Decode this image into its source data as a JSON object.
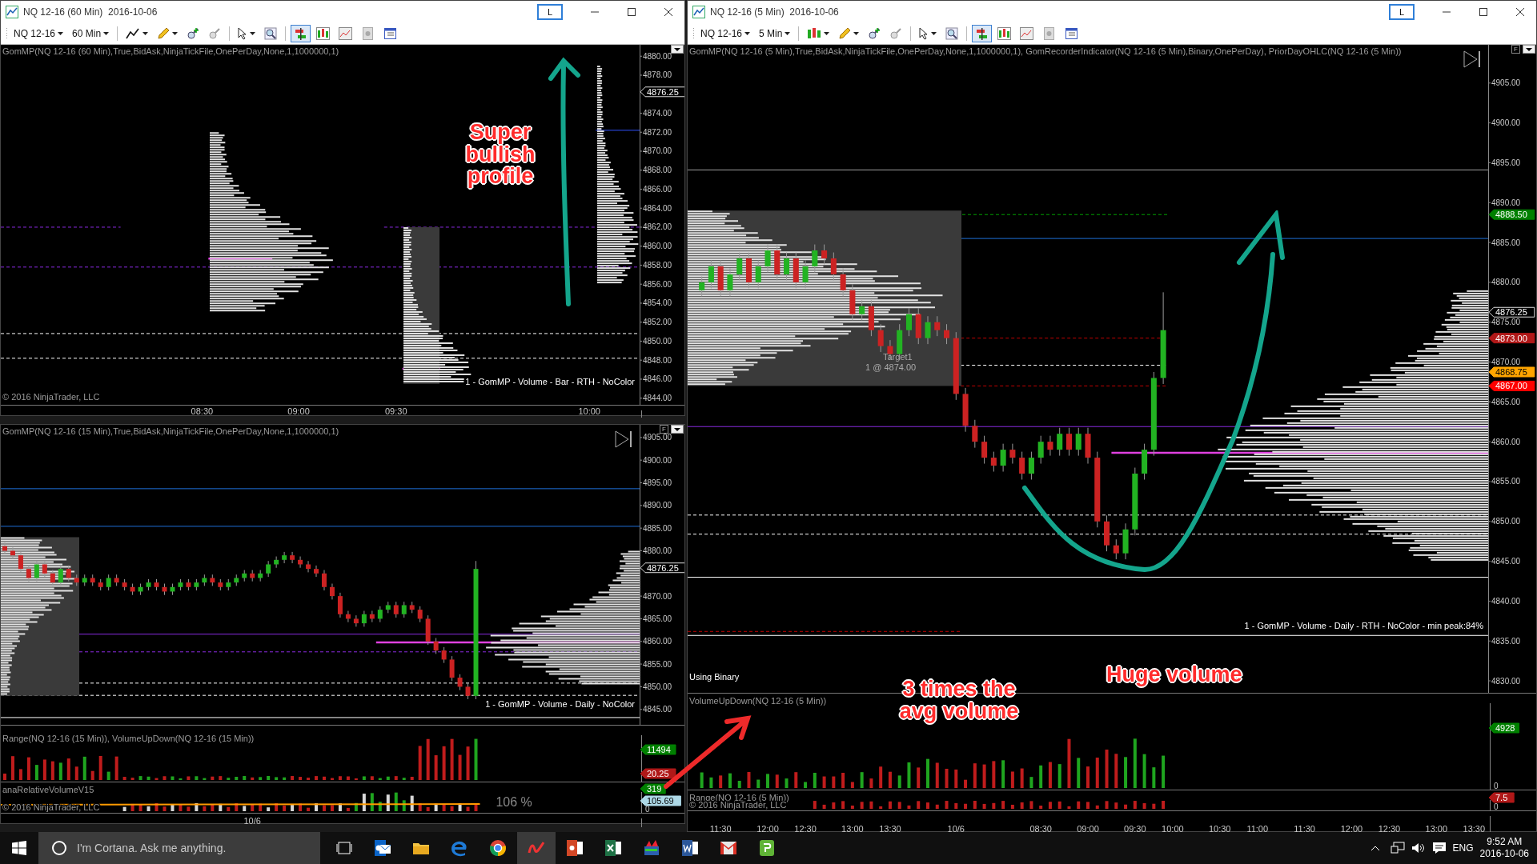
{
  "windows": [
    {
      "title": "NQ 12-16 (60 Min)  2016-10-06",
      "link_button": "L",
      "instrument": "NQ 12-16",
      "interval": "60 Min",
      "chart_style": {
        "kind": "line"
      },
      "view_buttons": [
        {
          "kind": "trader",
          "selected": true
        },
        {
          "kind": "candles",
          "selected": false
        },
        {
          "kind": "chart",
          "selected": false
        },
        {
          "kind": "dollar",
          "selected": false
        },
        {
          "kind": "table",
          "selected": false
        }
      ],
      "indicator_label": "GomMP(NQ 12-16 (60 Min),True,BidAsk,NinjaTickFile,OnePerDay,None,1,1000000,1)",
      "copyright": "© 2016 NinjaTrader, LLC",
      "profile_label": "1 - GomMP - Volume - Bar - RTH - NoColor",
      "price_axis": [
        "4880.00",
        "4878.00",
        "4874.00",
        "4872.00",
        "4870.00",
        "4868.00",
        "4866.00",
        "4864.00",
        "4862.00",
        "4860.00",
        "4858.00",
        "4856.00",
        "4854.00",
        "4852.00",
        "4850.00",
        "4848.00",
        "4846.00",
        "4844.00"
      ],
      "time_axis": [
        "08:30",
        "09:00",
        "09:30",
        "10:00"
      ],
      "price_markers": [
        {
          "text": "4876.25",
          "color": "#000000"
        }
      ]
    },
    {
      "f_button": "F",
      "indicator_label": "GomMP(NQ 12-16 (15 Min),True,BidAsk,NinjaTickFile,OnePerDay,None,1,1000000,1)",
      "profile_label": "1 - GomMP - Volume - Daily - NoColor",
      "price_markers": [
        {
          "text": "4876.25",
          "color": "#000000"
        }
      ],
      "time_axis": [
        "10/6"
      ],
      "chart_data": {
        "type": "candlestick",
        "ylim": [
          4841.6,
          4907.8
        ],
        "yticks": [
          {
            "value": 4905,
            "label": "4905.00"
          },
          {
            "value": 4900,
            "label": "4900.00"
          },
          {
            "value": 4895,
            "label": "4895.00"
          },
          {
            "value": 4890,
            "label": "4890.00"
          },
          {
            "value": 4885,
            "label": "4885.00"
          },
          {
            "value": 4880,
            "label": "4880.00"
          },
          {
            "value": 4870,
            "label": "4870.00"
          },
          {
            "value": 4865,
            "label": "4865.00"
          },
          {
            "value": 4860,
            "label": "4860.00"
          },
          {
            "value": 4855,
            "label": "4855.00"
          },
          {
            "value": 4850,
            "label": "4850.00"
          },
          {
            "value": 4845,
            "label": "4845.00"
          }
        ],
        "categories": [
          null,
          null,
          null,
          null,
          null,
          null,
          null,
          null,
          null,
          null,
          null,
          null,
          null,
          null,
          null,
          null,
          null,
          null,
          null,
          null,
          null,
          null,
          null,
          null,
          null,
          null,
          null,
          null,
          null,
          null,
          null,
          null,
          null,
          null,
          null,
          null,
          null,
          null,
          null,
          null,
          null,
          null,
          null,
          null,
          null,
          null,
          null,
          null,
          null,
          null,
          null,
          null,
          null,
          null,
          null,
          null,
          null,
          null,
          null,
          null,
          null,
          null,
          null,
          null,
          null,
          null,
          null,
          null,
          null,
          null,
          null,
          null,
          null,
          null,
          null,
          null,
          null,
          null,
          null,
          null
        ],
        "ohlc": [
          [
            4881,
            4881.75,
            4879.25,
            4880
          ],
          [
            4880,
            4880.75,
            4878.25,
            4879
          ],
          [
            4879,
            4879.75,
            4875.25,
            4876
          ],
          [
            4876,
            4876.75,
            4873.25,
            4874
          ],
          [
            4874,
            4877.75,
            4873.25,
            4877
          ],
          [
            4877,
            4877.75,
            4874.25,
            4875
          ],
          [
            4875,
            4875.75,
            4872.25,
            4873
          ],
          [
            4873,
            4876.75,
            4872.25,
            4876
          ],
          [
            4876,
            4876.75,
            4873.25,
            4874
          ],
          [
            4874,
            4874.75,
            4872.25,
            4873
          ],
          [
            4873,
            4874.75,
            4872.25,
            4874
          ],
          [
            4874,
            4874.75,
            4872.25,
            4873
          ],
          [
            4873,
            4873.75,
            4871.25,
            4872
          ],
          [
            4872,
            4874.75,
            4871.25,
            4874
          ],
          [
            4874,
            4874.75,
            4872.25,
            4873
          ],
          [
            4873,
            4873.75,
            4871.25,
            4872
          ],
          [
            4872,
            4872.75,
            4870.25,
            4871
          ],
          [
            4871,
            4872.75,
            4870.25,
            4872
          ],
          [
            4872,
            4873.75,
            4871.25,
            4873
          ],
          [
            4873,
            4873.75,
            4871.25,
            4872
          ],
          [
            4872,
            4872.75,
            4870.25,
            4871
          ],
          [
            4871,
            4872.75,
            4870.25,
            4872
          ],
          [
            4872,
            4873.75,
            4871.25,
            4873
          ],
          [
            4873,
            4873.75,
            4871.25,
            4872
          ],
          [
            4872,
            4873.75,
            4871.25,
            4873
          ],
          [
            4873,
            4874.75,
            4872.25,
            4874
          ],
          [
            4874,
            4874.75,
            4872.25,
            4873
          ],
          [
            4873,
            4873.75,
            4871.25,
            4872
          ],
          [
            4872,
            4873.75,
            4871.25,
            4873
          ],
          [
            4873,
            4874.75,
            4872.25,
            4874
          ],
          [
            4874,
            4875.75,
            4873.25,
            4875
          ],
          [
            4875,
            4875.75,
            4873.25,
            4874
          ],
          [
            4874,
            4875.75,
            4873.25,
            4875
          ],
          [
            4875,
            4877.75,
            4874.25,
            4877
          ],
          [
            4877,
            4878.75,
            4876.25,
            4878
          ],
          [
            4878,
            4879.75,
            4877.25,
            4879
          ],
          [
            4879,
            4879.75,
            4877.25,
            4878
          ],
          [
            4878,
            4878.75,
            4876.25,
            4877
          ],
          [
            4877,
            4877.75,
            4875.25,
            4876
          ],
          [
            4876,
            4876.75,
            4874.25,
            4875
          ],
          [
            4875,
            4875.75,
            4871.25,
            4872
          ],
          [
            4872,
            4872.75,
            4869.25,
            4870
          ],
          [
            4870,
            4870.75,
            4865.25,
            4866
          ],
          [
            4866,
            4866.75,
            4864.25,
            4865
          ],
          [
            4865,
            4865.75,
            4863.25,
            4864
          ],
          [
            4864,
            4866.75,
            4863.25,
            4866
          ],
          [
            4866,
            4866.75,
            4864.25,
            4865
          ],
          [
            4865,
            4867.75,
            4864.25,
            4867
          ],
          [
            4867,
            4868.75,
            4866.25,
            4868
          ],
          [
            4868,
            4868.75,
            4865.25,
            4866
          ],
          [
            4866,
            4868.75,
            4865.25,
            4868
          ],
          [
            4868,
            4868.75,
            4866.25,
            4867
          ],
          [
            4867,
            4867.75,
            4864.25,
            4865
          ],
          [
            4865,
            4865.75,
            4859.25,
            4860
          ],
          [
            4860,
            4860.75,
            4857.25,
            4858
          ],
          [
            4858,
            4858.75,
            4855.25,
            4856
          ],
          [
            4856,
            4856.75,
            4851.25,
            4852
          ],
          [
            4852,
            4852.75,
            4849.25,
            4850
          ],
          [
            4850,
            4850.75,
            4847.25,
            4848
          ],
          [
            4848,
            4877.75,
            4847.25,
            4876
          ],
          null,
          null,
          null,
          null,
          null,
          null,
          null,
          null,
          null,
          null,
          null,
          null,
          null,
          null,
          null,
          null,
          null,
          null,
          null,
          null
        ]
      },
      "sub_panels": [
        {
          "kind": "volume",
          "label": "Range(NQ 12-16 (15 Min)), VolumeUpDown(NQ 12-16 (15 Min))",
          "markers": [
            {
              "text": "11494",
              "color": "#008000"
            },
            {
              "text": "20.25",
              "color": "#b01818"
            }
          ]
        },
        {
          "kind": "relative",
          "label": "anaRelativeVolumeV15",
          "copyright": "© 2016 NinjaTrader, LLC",
          "reading": "106 %",
          "markers": [
            {
              "text": "319",
              "color": "#008000"
            },
            {
              "text": "105.69",
              "color": "#add8e6"
            }
          ],
          "axis": [
            "0"
          ]
        }
      ]
    },
    {
      "title": "NQ 12-16 (5 Min)  2016-10-06",
      "link_button": "L",
      "instrument": "NQ 12-16",
      "interval": "5 Min",
      "chart_style": {
        "kind": "candlestick"
      },
      "f_button": "F",
      "view_buttons": [
        {
          "kind": "trader",
          "selected": true
        },
        {
          "kind": "candles",
          "selected": false
        },
        {
          "kind": "chart",
          "selected": false
        },
        {
          "kind": "dollar",
          "selected": false
        },
        {
          "kind": "table",
          "selected": false
        }
      ],
      "indicator_label": "GomMP(NQ 12-16 (5 Min),True,BidAsk,NinjaTickFile,OnePerDay,None,1,1000000,1), GomRecorderIndicator(NQ 12-16 (5 Min),Binary,OnePerDay), PriorDayOHLC(NQ 12-16 (5 Min))",
      "order_label": "Target1",
      "order_detail": "1 @ 4874.00",
      "status_label": "Using Binary",
      "profile_label": "1 - GomMP - Volume - Daily - RTH - NoColor - min peak:84%",
      "price_markers": [
        {
          "text": "4888.50",
          "color": "#008000"
        },
        {
          "text": "4876.25",
          "color": "#000000"
        },
        {
          "text": "4873.00",
          "color": "#b01818"
        },
        {
          "text": "4868.75",
          "color": "#ffa500"
        },
        {
          "text": "4867.00",
          "color": "#ff0000"
        }
      ],
      "time_axis": [
        "11:30",
        "12:00",
        "12:30",
        "13:00",
        "13:30",
        "10/6",
        "08:30",
        "09:00",
        "09:30",
        "10:00",
        "10:30",
        "11:00",
        "11:30",
        "12:00",
        "12:30",
        "13:00",
        "13:30"
      ],
      "chart_data": {
        "type": "candlestick",
        "ylim": [
          4828.5,
          4909.8
        ],
        "yticks": [
          {
            "value": 4905,
            "label": "4905.00"
          },
          {
            "value": 4900,
            "label": "4900.00"
          },
          {
            "value": 4895,
            "label": "4895.00"
          },
          {
            "value": 4890,
            "label": "4890.00"
          },
          {
            "value": 4885,
            "label": "4885.00"
          },
          {
            "value": 4880,
            "label": "4880.00"
          },
          {
            "value": 4875,
            "label": "4875.00"
          },
          {
            "value": 4870,
            "label": "4870.00"
          },
          {
            "value": 4865,
            "label": "4865.00"
          },
          {
            "value": 4860,
            "label": "4860.00"
          },
          {
            "value": 4855,
            "label": "4855.00"
          },
          {
            "value": 4850,
            "label": "4850.00"
          },
          {
            "value": 4845,
            "label": "4845.00"
          },
          {
            "value": 4840,
            "label": "4840.00"
          },
          {
            "value": 4835,
            "label": "4835.00"
          },
          {
            "value": 4830,
            "label": "4830.00"
          }
        ],
        "categories": [
          null,
          null,
          null,
          null,
          null,
          null,
          null,
          null,
          null,
          null,
          null,
          null,
          null,
          null,
          null,
          null,
          null,
          null,
          null,
          null,
          null,
          null,
          null,
          null,
          null,
          null,
          null,
          null,
          null,
          null,
          null,
          null,
          null,
          null,
          null,
          null,
          null,
          null,
          null,
          null,
          null,
          null,
          null,
          null,
          null,
          null,
          null,
          null,
          null,
          null,
          null,
          null,
          null,
          null,
          null,
          null,
          null,
          null,
          null,
          null,
          null,
          null,
          null,
          null,
          null,
          null,
          null,
          null,
          null,
          null,
          null,
          null,
          null,
          null,
          null,
          null,
          null,
          null,
          null,
          null,
          null,
          null,
          null,
          null,
          null
        ],
        "ohlc": [
          null,
          [
            4879,
            4880.75,
            4878.25,
            4880
          ],
          [
            4880,
            4882.75,
            4879.25,
            4882
          ],
          [
            4882,
            4882.75,
            4878.25,
            4879
          ],
          [
            4879,
            4881.75,
            4878.25,
            4881
          ],
          [
            4881,
            4883.75,
            4880.25,
            4883
          ],
          [
            4883,
            4883.75,
            4879.25,
            4880
          ],
          [
            4880,
            4882.75,
            4879.25,
            4882
          ],
          [
            4882,
            4884.75,
            4881.25,
            4884
          ],
          [
            4884,
            4884.75,
            4880.25,
            4881
          ],
          [
            4881,
            4883.75,
            4880.25,
            4883
          ],
          [
            4883,
            4883.75,
            4879.25,
            4880
          ],
          [
            4880,
            4882.75,
            4879.25,
            4882
          ],
          [
            4882,
            4884.75,
            4881.25,
            4884
          ],
          [
            4884,
            4884.75,
            4882.25,
            4883
          ],
          [
            4883,
            4883.75,
            4880.25,
            4881
          ],
          [
            4881,
            4881.75,
            4878.25,
            4879
          ],
          [
            4879,
            4879.75,
            4875.25,
            4876
          ],
          [
            4876,
            4877.75,
            4875.25,
            4877
          ],
          [
            4877,
            4877.75,
            4873.25,
            4874
          ],
          [
            4874,
            4874.75,
            4871.25,
            4872
          ],
          [
            4872,
            4872.75,
            4870.25,
            4871
          ],
          [
            4871,
            4874.75,
            4870.25,
            4874
          ],
          [
            4874,
            4876.75,
            4873.25,
            4876
          ],
          [
            4876,
            4876.75,
            4872.25,
            4873
          ],
          [
            4873,
            4875.75,
            4872.25,
            4875
          ],
          [
            4875,
            4875.75,
            4873.25,
            4874
          ],
          [
            4874,
            4874.75,
            4872.25,
            4873
          ],
          [
            4873,
            4873.75,
            4865.25,
            4866
          ],
          [
            4866,
            4866.75,
            4861.25,
            4862
          ],
          [
            4862,
            4862.75,
            4859.25,
            4860
          ],
          [
            4860,
            4860.75,
            4857.25,
            4858
          ],
          [
            4858,
            4858.75,
            4856.25,
            4857
          ],
          [
            4857,
            4859.75,
            4856.25,
            4859
          ],
          [
            4859,
            4859.75,
            4857.25,
            4858
          ],
          [
            4858,
            4858.75,
            4855.25,
            4856
          ],
          [
            4856,
            4858.75,
            4855.25,
            4858
          ],
          [
            4858,
            4860.75,
            4857.25,
            4860
          ],
          [
            4860,
            4860.75,
            4858.25,
            4859
          ],
          [
            4859,
            4861.75,
            4858.25,
            4861
          ],
          [
            4861,
            4861.75,
            4858.25,
            4859
          ],
          [
            4859,
            4861.75,
            4858.25,
            4861
          ],
          [
            4861,
            4861.75,
            4857.25,
            4858
          ],
          [
            4858,
            4858.75,
            4849.25,
            4850
          ],
          [
            4850,
            4850.75,
            4846.25,
            4847
          ],
          [
            4847,
            4847.75,
            4845.25,
            4846
          ],
          [
            4846,
            4849.75,
            4845.25,
            4849
          ],
          [
            4849,
            4856.75,
            4848.25,
            4856
          ],
          [
            4856,
            4859.75,
            4855.25,
            4859
          ],
          [
            4859,
            4868.75,
            4858.25,
            4868
          ],
          [
            4868,
            4878.75,
            4867.25,
            4874
          ],
          null,
          null,
          null,
          null,
          null,
          null,
          null,
          null,
          null,
          null,
          null,
          null,
          null,
          null,
          null,
          null,
          null,
          null,
          null,
          null,
          null,
          null,
          null,
          null,
          null,
          null,
          null,
          null,
          null,
          null,
          null,
          null,
          null,
          null
        ]
      },
      "sub_panels": [
        {
          "kind": "volume",
          "label": "VolumeUpDown(NQ 12-16 (5 Min))",
          "markers": [
            {
              "text": "4928",
              "color": "#008000"
            }
          ],
          "axis": [
            "0"
          ]
        },
        {
          "kind": "range",
          "label": "Range(NQ 12-16 (5 Min))",
          "copyright": "© 2016 NinjaTrader, LLC",
          "markers": [
            {
              "text": "7.5",
              "color": "#b01818"
            }
          ],
          "axis": [
            "0"
          ]
        }
      ]
    }
  ],
  "annotations": [
    {
      "text": "Super bullish profile"
    },
    {
      "text": "3 times the avg volume"
    },
    {
      "text": "Huge volume"
    }
  ],
  "taskbar": {
    "search_placeholder": "I'm Cortana. Ask me anything.",
    "apps": [
      {
        "kind": "mail",
        "selected": false
      },
      {
        "kind": "folder",
        "selected": false
      },
      {
        "kind": "browser-e",
        "selected": false
      },
      {
        "kind": "browser-c",
        "selected": false
      },
      {
        "kind": "trading",
        "selected": true
      },
      {
        "kind": "slides",
        "selected": false
      },
      {
        "kind": "sheet",
        "selected": false
      },
      {
        "kind": "tws",
        "selected": false
      },
      {
        "kind": "doc",
        "selected": false
      },
      {
        "kind": "redmail",
        "selected": false
      },
      {
        "kind": "notes",
        "selected": false
      }
    ],
    "language": "ENG",
    "time": "9:52 AM",
    "date": "2016-10-06"
  }
}
